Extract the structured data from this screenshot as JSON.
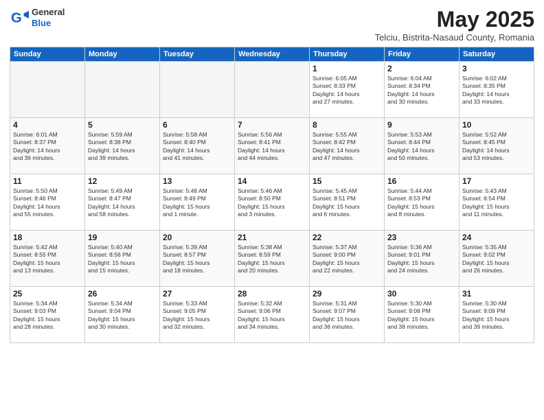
{
  "header": {
    "logo_general": "General",
    "logo_blue": "Blue",
    "title": "May 2025",
    "location": "Telciu, Bistrita-Nasaud County, Romania"
  },
  "days_of_week": [
    "Sunday",
    "Monday",
    "Tuesday",
    "Wednesday",
    "Thursday",
    "Friday",
    "Saturday"
  ],
  "weeks": [
    [
      {
        "num": "",
        "info": ""
      },
      {
        "num": "",
        "info": ""
      },
      {
        "num": "",
        "info": ""
      },
      {
        "num": "",
        "info": ""
      },
      {
        "num": "1",
        "info": "Sunrise: 6:05 AM\nSunset: 8:33 PM\nDaylight: 14 hours\nand 27 minutes."
      },
      {
        "num": "2",
        "info": "Sunrise: 6:04 AM\nSunset: 8:34 PM\nDaylight: 14 hours\nand 30 minutes."
      },
      {
        "num": "3",
        "info": "Sunrise: 6:02 AM\nSunset: 8:35 PM\nDaylight: 14 hours\nand 33 minutes."
      }
    ],
    [
      {
        "num": "4",
        "info": "Sunrise: 6:01 AM\nSunset: 8:37 PM\nDaylight: 14 hours\nand 36 minutes."
      },
      {
        "num": "5",
        "info": "Sunrise: 5:59 AM\nSunset: 8:38 PM\nDaylight: 14 hours\nand 39 minutes."
      },
      {
        "num": "6",
        "info": "Sunrise: 5:58 AM\nSunset: 8:40 PM\nDaylight: 14 hours\nand 41 minutes."
      },
      {
        "num": "7",
        "info": "Sunrise: 5:56 AM\nSunset: 8:41 PM\nDaylight: 14 hours\nand 44 minutes."
      },
      {
        "num": "8",
        "info": "Sunrise: 5:55 AM\nSunset: 8:42 PM\nDaylight: 14 hours\nand 47 minutes."
      },
      {
        "num": "9",
        "info": "Sunrise: 5:53 AM\nSunset: 8:44 PM\nDaylight: 14 hours\nand 50 minutes."
      },
      {
        "num": "10",
        "info": "Sunrise: 5:52 AM\nSunset: 8:45 PM\nDaylight: 14 hours\nand 53 minutes."
      }
    ],
    [
      {
        "num": "11",
        "info": "Sunrise: 5:50 AM\nSunset: 8:46 PM\nDaylight: 14 hours\nand 55 minutes."
      },
      {
        "num": "12",
        "info": "Sunrise: 5:49 AM\nSunset: 8:47 PM\nDaylight: 14 hours\nand 58 minutes."
      },
      {
        "num": "13",
        "info": "Sunrise: 5:48 AM\nSunset: 8:49 PM\nDaylight: 15 hours\nand 1 minute."
      },
      {
        "num": "14",
        "info": "Sunrise: 5:46 AM\nSunset: 8:50 PM\nDaylight: 15 hours\nand 3 minutes."
      },
      {
        "num": "15",
        "info": "Sunrise: 5:45 AM\nSunset: 8:51 PM\nDaylight: 15 hours\nand 6 minutes."
      },
      {
        "num": "16",
        "info": "Sunrise: 5:44 AM\nSunset: 8:53 PM\nDaylight: 15 hours\nand 8 minutes."
      },
      {
        "num": "17",
        "info": "Sunrise: 5:43 AM\nSunset: 8:54 PM\nDaylight: 15 hours\nand 11 minutes."
      }
    ],
    [
      {
        "num": "18",
        "info": "Sunrise: 5:42 AM\nSunset: 8:55 PM\nDaylight: 15 hours\nand 13 minutes."
      },
      {
        "num": "19",
        "info": "Sunrise: 5:40 AM\nSunset: 8:56 PM\nDaylight: 15 hours\nand 15 minutes."
      },
      {
        "num": "20",
        "info": "Sunrise: 5:39 AM\nSunset: 8:57 PM\nDaylight: 15 hours\nand 18 minutes."
      },
      {
        "num": "21",
        "info": "Sunrise: 5:38 AM\nSunset: 8:59 PM\nDaylight: 15 hours\nand 20 minutes."
      },
      {
        "num": "22",
        "info": "Sunrise: 5:37 AM\nSunset: 9:00 PM\nDaylight: 15 hours\nand 22 minutes."
      },
      {
        "num": "23",
        "info": "Sunrise: 5:36 AM\nSunset: 9:01 PM\nDaylight: 15 hours\nand 24 minutes."
      },
      {
        "num": "24",
        "info": "Sunrise: 5:35 AM\nSunset: 9:02 PM\nDaylight: 15 hours\nand 26 minutes."
      }
    ],
    [
      {
        "num": "25",
        "info": "Sunrise: 5:34 AM\nSunset: 9:03 PM\nDaylight: 15 hours\nand 28 minutes."
      },
      {
        "num": "26",
        "info": "Sunrise: 5:34 AM\nSunset: 9:04 PM\nDaylight: 15 hours\nand 30 minutes."
      },
      {
        "num": "27",
        "info": "Sunrise: 5:33 AM\nSunset: 9:05 PM\nDaylight: 15 hours\nand 32 minutes."
      },
      {
        "num": "28",
        "info": "Sunrise: 5:32 AM\nSunset: 9:06 PM\nDaylight: 15 hours\nand 34 minutes."
      },
      {
        "num": "29",
        "info": "Sunrise: 5:31 AM\nSunset: 9:07 PM\nDaylight: 15 hours\nand 36 minutes."
      },
      {
        "num": "30",
        "info": "Sunrise: 5:30 AM\nSunset: 9:08 PM\nDaylight: 15 hours\nand 38 minutes."
      },
      {
        "num": "31",
        "info": "Sunrise: 5:30 AM\nSunset: 9:09 PM\nDaylight: 15 hours\nand 39 minutes."
      }
    ]
  ]
}
